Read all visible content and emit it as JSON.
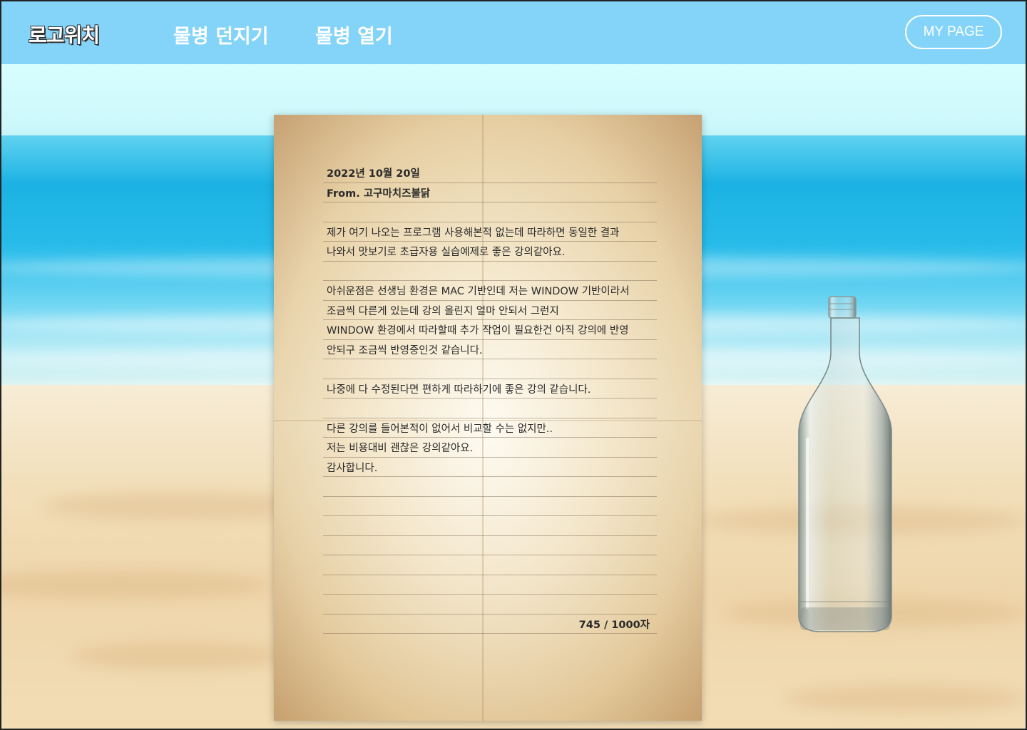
{
  "nav": {
    "logo": "로고위치",
    "links": [
      "물병 던지기",
      "물병 열기"
    ],
    "mypage": "MY PAGE"
  },
  "letter": {
    "date": "2022년 10월 20일",
    "from": "From. 고구마치즈불닭",
    "lines": [
      "",
      "제가 여기 나오는 프로그램 사용해본적 없는데 따라하면 동일한 결과",
      "나와서 맛보기로 초급자용 실습예제로 좋은 강의같아요.",
      "",
      "아쉬운점은 선생님 환경은 MAC 기반인데 저는 WINDOW 기반이라서",
      "조금씩 다른게 있는데 강의 올린지 얼마 안되서 그런지",
      "WINDOW 환경에서 따라할때 추가 작업이 필요한건 아직 강의에 반영",
      "안되구 조금씩 반영중인것 같습니다.",
      "",
      "나중에 다 수정된다면 편하게 따라하기에 좋은 강의 같습니다.",
      "",
      "다른 강의를 들어본적이 없어서 비교할 수는 없지만..",
      "저는 비용대비 괜찮은 강의같아요.",
      "감사합니다.",
      "",
      "",
      "",
      "",
      "",
      "",
      ""
    ],
    "counter": "745 / 1000자"
  }
}
